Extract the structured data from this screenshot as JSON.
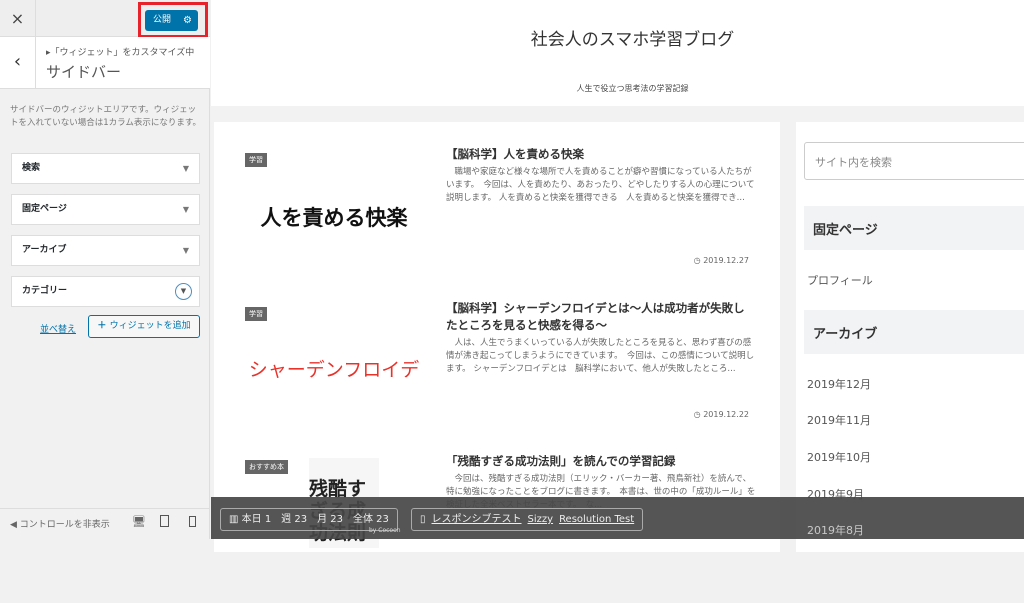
{
  "customizer": {
    "close_icon": "×",
    "publish_label": "公開",
    "breadcrumb": "▸「ウィジェット」をカスタマイズ中",
    "section_title": "サイドバー",
    "description": "サイドバーのウィジットエリアです。ウィジェットを入れていない場合は1カラム表示になります。",
    "widgets": [
      {
        "label": "検索"
      },
      {
        "label": "固定ページ"
      },
      {
        "label": "アーカイブ"
      },
      {
        "label": "カテゴリー"
      }
    ],
    "reorder_label": "並べ替え",
    "add_widget_label": "ウィジェットを追加",
    "hide_controls_label": "コントロールを非表示"
  },
  "site": {
    "title": "社会人のスマホ学習ブログ",
    "tagline": "人生で役立つ思考法の学習記録"
  },
  "posts": [
    {
      "category": "学習",
      "thumb_text": "人を責める快楽",
      "thumb_color": "#111111",
      "title": "【脳科学】人を責める快楽",
      "excerpt": "職場や家庭など様々な場所で人を責めることが癖や習慣になっている人たちがいます。　今回は、人を責めたり、あおったり、どやしたりする人の心理について説明します。 人を責めると快楽を獲得できる　人を責めると快楽を獲得でき...",
      "date": "2019.12.27"
    },
    {
      "category": "学習",
      "thumb_text": "シャーデンフロイデ",
      "thumb_color": "#e8322a",
      "title": "【脳科学】シャーデンフロイデとは〜人は成功者が失敗したところを見ると快感を得る〜",
      "excerpt": "人は、人生でうまくいっている人が失敗したところを見ると、思わず喜びの感情が沸き起こってしまうようにできています。　今回は、この感情について説明します。 シャーデンフロイデとは　脳科学において、他人が失敗したところ...",
      "date": "2019.12.22"
    },
    {
      "category": "おすすめ本",
      "thumb_text": "残酷すぎる成功法則",
      "thumb_color": "#222222",
      "title": "「残酷すぎる成功法則」を読んでの学習記録",
      "excerpt": "今回は、残酷すぎる成功法則（エリック・バーカー著、飛鳥新社）を読んで、特に勉強になったことをブログに書きます。　本書は、世の中の「成功ルール」を検証した全米ベストセラー本です。　な...",
      "date": ""
    }
  ],
  "sidebar": {
    "search_placeholder": "サイト内を検索",
    "pages_heading": "固定ページ",
    "pages": [
      "プロフィール"
    ],
    "archive_heading": "アーカイブ",
    "archives": [
      "2019年12月",
      "2019年11月",
      "2019年10月",
      "2019年9月",
      "2019年8月"
    ]
  },
  "toolbar": {
    "stats": "本日 1　週 23　月 23　全体 23",
    "by": "by Cocoon",
    "responsive": "レスポンシブテスト",
    "sizzy": "Sizzy",
    "resolution": "Resolution Test"
  }
}
